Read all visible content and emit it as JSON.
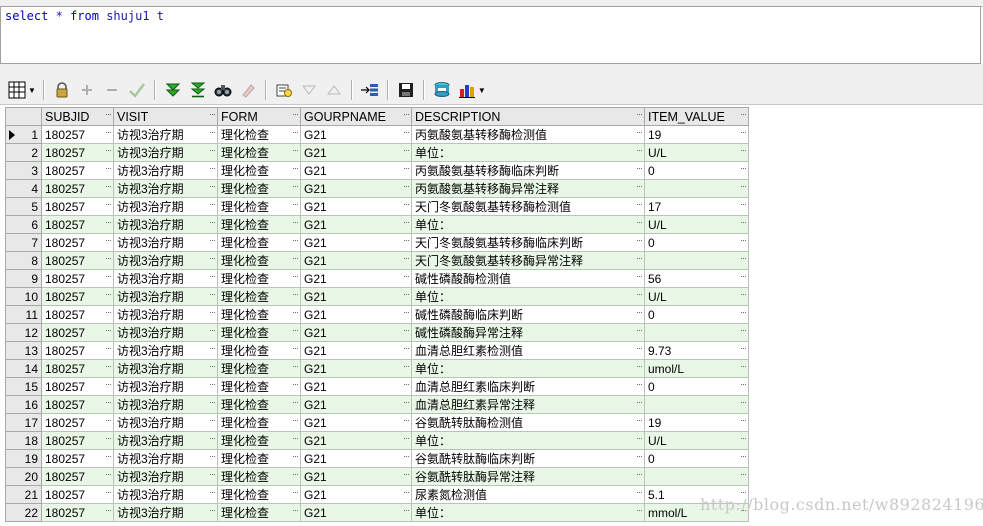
{
  "editor": {
    "sql_keyword_select": "select",
    "sql_star": "*",
    "sql_keyword_from": "from",
    "sql_table": "shuju1",
    "sql_alias": "t"
  },
  "toolbar": {
    "icons": [
      "grid-icon",
      "lock-icon",
      "add-icon",
      "remove-icon",
      "post-icon",
      "next-page-icon",
      "last-page-icon",
      "find-icon",
      "clear-icon",
      "query-icon",
      "sort-down-icon",
      "sort-up-icon",
      "record-icon",
      "save-icon",
      "export-icon",
      "chart-icon"
    ]
  },
  "grid": {
    "columns": [
      "SUBJID",
      "VISIT",
      "FORM",
      "GOURPNAME",
      "DESCRIPTION",
      "ITEM_VALUE"
    ],
    "rows": [
      {
        "n": "1",
        "subjid": "180257",
        "visit": "访视3治疗期",
        "form": "理化检查",
        "group": "G21",
        "desc": "丙氨酸氨基转移酶检测值",
        "value": "19"
      },
      {
        "n": "2",
        "subjid": "180257",
        "visit": "访视3治疗期",
        "form": "理化检查",
        "group": "G21",
        "desc": "单位：",
        "value": "U/L"
      },
      {
        "n": "3",
        "subjid": "180257",
        "visit": "访视3治疗期",
        "form": "理化检查",
        "group": "G21",
        "desc": "丙氨酸氨基转移酶临床判断",
        "value": "0"
      },
      {
        "n": "4",
        "subjid": "180257",
        "visit": "访视3治疗期",
        "form": "理化检查",
        "group": "G21",
        "desc": "丙氨酸氨基转移酶异常注释",
        "value": ""
      },
      {
        "n": "5",
        "subjid": "180257",
        "visit": "访视3治疗期",
        "form": "理化检查",
        "group": "G21",
        "desc": "天门冬氨酸氨基转移酶检测值",
        "value": "17"
      },
      {
        "n": "6",
        "subjid": "180257",
        "visit": "访视3治疗期",
        "form": "理化检查",
        "group": "G21",
        "desc": "单位：",
        "value": "U/L"
      },
      {
        "n": "7",
        "subjid": "180257",
        "visit": "访视3治疗期",
        "form": "理化检查",
        "group": "G21",
        "desc": "天门冬氨酸氨基转移酶临床判断",
        "value": "0"
      },
      {
        "n": "8",
        "subjid": "180257",
        "visit": "访视3治疗期",
        "form": "理化检查",
        "group": "G21",
        "desc": "天门冬氨酸氨基转移酶异常注释",
        "value": ""
      },
      {
        "n": "9",
        "subjid": "180257",
        "visit": "访视3治疗期",
        "form": "理化检查",
        "group": "G21",
        "desc": "碱性磷酸酶检测值",
        "value": "56"
      },
      {
        "n": "10",
        "subjid": "180257",
        "visit": "访视3治疗期",
        "form": "理化检查",
        "group": "G21",
        "desc": "单位：",
        "value": "U/L"
      },
      {
        "n": "11",
        "subjid": "180257",
        "visit": "访视3治疗期",
        "form": "理化检查",
        "group": "G21",
        "desc": "碱性磷酸酶临床判断",
        "value": "0"
      },
      {
        "n": "12",
        "subjid": "180257",
        "visit": "访视3治疗期",
        "form": "理化检查",
        "group": "G21",
        "desc": "碱性磷酸酶异常注释",
        "value": ""
      },
      {
        "n": "13",
        "subjid": "180257",
        "visit": "访视3治疗期",
        "form": "理化检查",
        "group": "G21",
        "desc": "血清总胆红素检测值",
        "value": "9.73"
      },
      {
        "n": "14",
        "subjid": "180257",
        "visit": "访视3治疗期",
        "form": "理化检查",
        "group": "G21",
        "desc": "单位：",
        "value": "umol/L"
      },
      {
        "n": "15",
        "subjid": "180257",
        "visit": "访视3治疗期",
        "form": "理化检查",
        "group": "G21",
        "desc": "血清总胆红素临床判断",
        "value": "0"
      },
      {
        "n": "16",
        "subjid": "180257",
        "visit": "访视3治疗期",
        "form": "理化检查",
        "group": "G21",
        "desc": "血清总胆红素异常注释",
        "value": ""
      },
      {
        "n": "17",
        "subjid": "180257",
        "visit": "访视3治疗期",
        "form": "理化检查",
        "group": "G21",
        "desc": "谷氨酰转肽酶检测值",
        "value": "19"
      },
      {
        "n": "18",
        "subjid": "180257",
        "visit": "访视3治疗期",
        "form": "理化检查",
        "group": "G21",
        "desc": "单位：",
        "value": "U/L"
      },
      {
        "n": "19",
        "subjid": "180257",
        "visit": "访视3治疗期",
        "form": "理化检查",
        "group": "G21",
        "desc": "谷氨酰转肽酶临床判断",
        "value": "0"
      },
      {
        "n": "20",
        "subjid": "180257",
        "visit": "访视3治疗期",
        "form": "理化检查",
        "group": "G21",
        "desc": "谷氨酰转肽酶异常注释",
        "value": ""
      },
      {
        "n": "21",
        "subjid": "180257",
        "visit": "访视3治疗期",
        "form": "理化检查",
        "group": "G21",
        "desc": "尿素氮检测值",
        "value": "5.1"
      },
      {
        "n": "22",
        "subjid": "180257",
        "visit": "访视3治疗期",
        "form": "理化检查",
        "group": "G21",
        "desc": "单位：",
        "value": "mmol/L"
      }
    ]
  },
  "watermark": "http://blog.csdn.net/w892824196",
  "colors": {
    "row_even": "#e9f8e6",
    "row_odd": "#ffffff",
    "header": "#e8e8e8",
    "sql_keyword": "#0000c0"
  }
}
